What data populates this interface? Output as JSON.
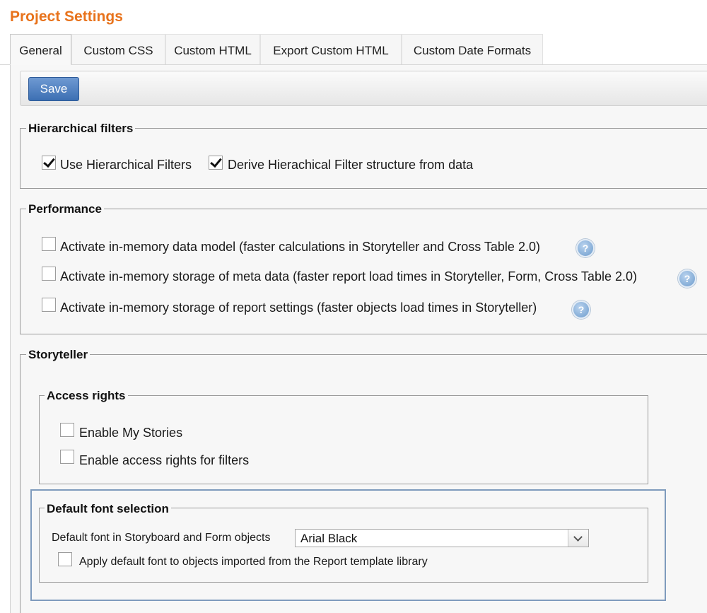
{
  "page": {
    "title": "Project Settings"
  },
  "tabs": [
    {
      "label": "General",
      "active": true
    },
    {
      "label": "Custom CSS",
      "active": false
    },
    {
      "label": "Custom HTML",
      "active": false
    },
    {
      "label": "Export Custom HTML",
      "active": false
    },
    {
      "label": "Custom Date Formats",
      "active": false
    }
  ],
  "toolbar": {
    "save_label": "Save"
  },
  "hierarchical_filters": {
    "legend": "Hierarchical filters",
    "items": [
      {
        "label": "Use Hierarchical Filters",
        "checked": true
      },
      {
        "label": "Derive Hierachical Filter structure from data",
        "checked": true
      }
    ]
  },
  "performance": {
    "legend": "Performance",
    "items": [
      {
        "label": "Activate in-memory data model (faster calculations in Storyteller and Cross Table 2.0)",
        "checked": false,
        "help_icon": "question-mark-icon"
      },
      {
        "label": "Activate in-memory storage of meta data (faster report load times in Storyteller, Form, Cross Table 2.0)",
        "checked": false,
        "help_icon": "question-mark-icon"
      },
      {
        "label": "Activate in-memory storage of report settings (faster objects load times in Storyteller)",
        "checked": false,
        "help_icon": "question-mark-icon"
      }
    ]
  },
  "storyteller": {
    "legend": "Storyteller",
    "access_rights": {
      "legend": "Access rights",
      "items": [
        {
          "label": "Enable My Stories",
          "checked": false
        },
        {
          "label": "Enable access rights for filters",
          "checked": false
        }
      ]
    },
    "default_font": {
      "legend": "Default font selection",
      "select_label": "Default font in Storyboard and Form objects",
      "select_value": "Arial Black",
      "apply_label": "Apply default font to objects imported from the Report template library",
      "apply_checked": false
    }
  },
  "colors": {
    "title": "#e8731c",
    "save_button": "#3c6fb3",
    "highlight_border": "#7f9bbd"
  }
}
